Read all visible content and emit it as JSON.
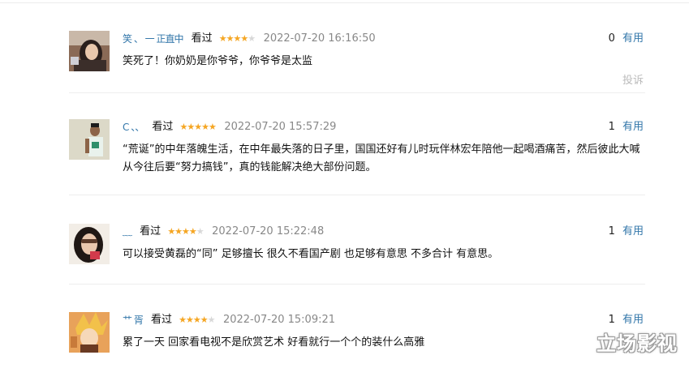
{
  "reviews": [
    {
      "username": "笑 、 一 正直中",
      "seen_label": "看过",
      "rating": 4,
      "time": "2022-07-20 16:16:50",
      "votes": "0",
      "useful_label": "有用",
      "content": "笑死了！你奶奶是你爷爷，你爷爷是太监",
      "report_label": "投诉",
      "avatar_icon": "avatar-woman-dark-hair"
    },
    {
      "username": "C 、、",
      "seen_label": "看过",
      "rating": 5,
      "time": "2022-07-20 15:57:29",
      "votes": "1",
      "useful_label": "有用",
      "content": "“荒诞”的中年落魄生活，在中年最失落的日子里，国国还好有儿时玩伴林宏年陪他一起喝酒痛苦，然后彼此大喊从今往后要“努力搞钱”，真的钱能解决绝大部份问题。",
      "avatar_icon": "avatar-man-green-shirt"
    },
    {
      "username": "﹏",
      "seen_label": "看过",
      "rating": 4,
      "time": "2022-07-20 15:22:48",
      "votes": "1",
      "useful_label": "有用",
      "content": "可以接受黄磊的“同” 足够擅长 很久不看国产剧 也足够有意思 不多合计 有意思。",
      "avatar_icon": "avatar-woman-glasses"
    },
    {
      "username": "艹 胥",
      "seen_label": "看过",
      "rating": 4,
      "time": "2022-07-20 15:09:21",
      "votes": "1",
      "useful_label": "有用",
      "content": "累了一天 回家看电视不是欣赏艺术 好看就行一个个的装什么高雅",
      "avatar_icon": "avatar-anime-character"
    }
  ],
  "watermark": "立场影视",
  "colors": {
    "link": "#3377aa",
    "star": "#f5a623",
    "meta": "#888888"
  }
}
